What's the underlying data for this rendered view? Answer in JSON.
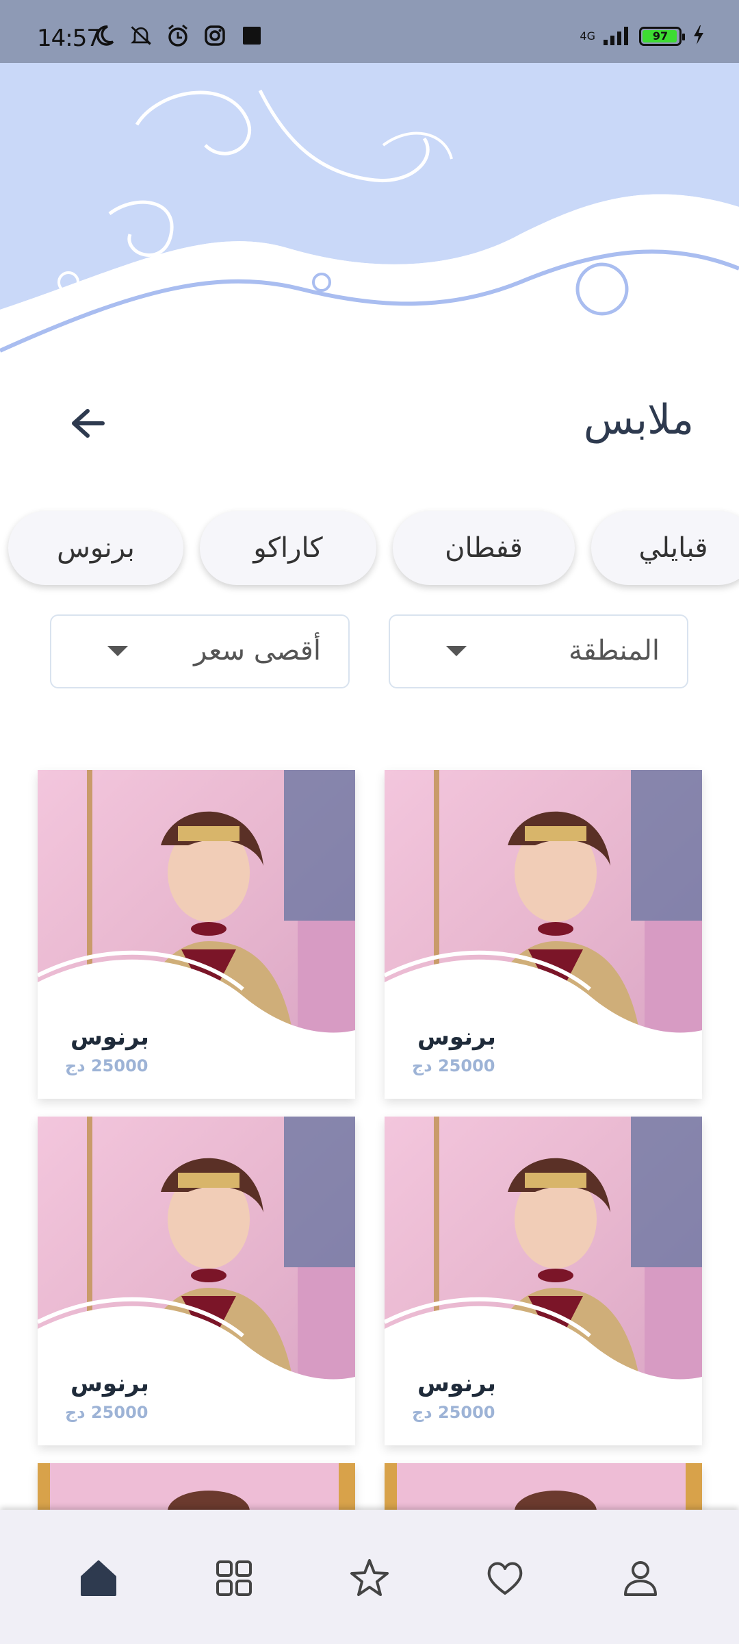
{
  "status_bar": {
    "time": "14:57",
    "network": "4G",
    "battery": "97",
    "icons": [
      "moon-icon",
      "mute-icon",
      "alarm-icon",
      "instagram-icon",
      "square-icon"
    ]
  },
  "header": {
    "title": "ملابس",
    "back_icon": "arrow-left-icon"
  },
  "chips": [
    {
      "label": "قبايلي"
    },
    {
      "label": "قفطان"
    },
    {
      "label": "كاراكو"
    },
    {
      "label": "برنوس"
    }
  ],
  "filters": {
    "region": {
      "label": "المنطقة"
    },
    "max_price": {
      "label": "أقصى سعر"
    }
  },
  "products": [
    {
      "name": "برنوس",
      "price": "25000 دج"
    },
    {
      "name": "برنوس",
      "price": "25000 دج"
    },
    {
      "name": "برنوس",
      "price": "25000 دج"
    },
    {
      "name": "برنوس",
      "price": "25000 دج"
    },
    {
      "name": "",
      "price": ""
    },
    {
      "name": "",
      "price": ""
    }
  ],
  "bottom_nav": [
    {
      "icon": "home-icon",
      "active": true
    },
    {
      "icon": "grid-icon",
      "active": false
    },
    {
      "icon": "star-icon",
      "active": false
    },
    {
      "icon": "heart-icon",
      "active": false
    },
    {
      "icon": "user-icon",
      "active": false
    }
  ],
  "colors": {
    "status_bar": "#8e9ab5",
    "header_wave": "#c9d8f8",
    "title_text": "#2e3a4f",
    "price_text": "#9db3d6",
    "nav_bg": "#f0eff6",
    "battery_fill": "#3ddc32"
  }
}
